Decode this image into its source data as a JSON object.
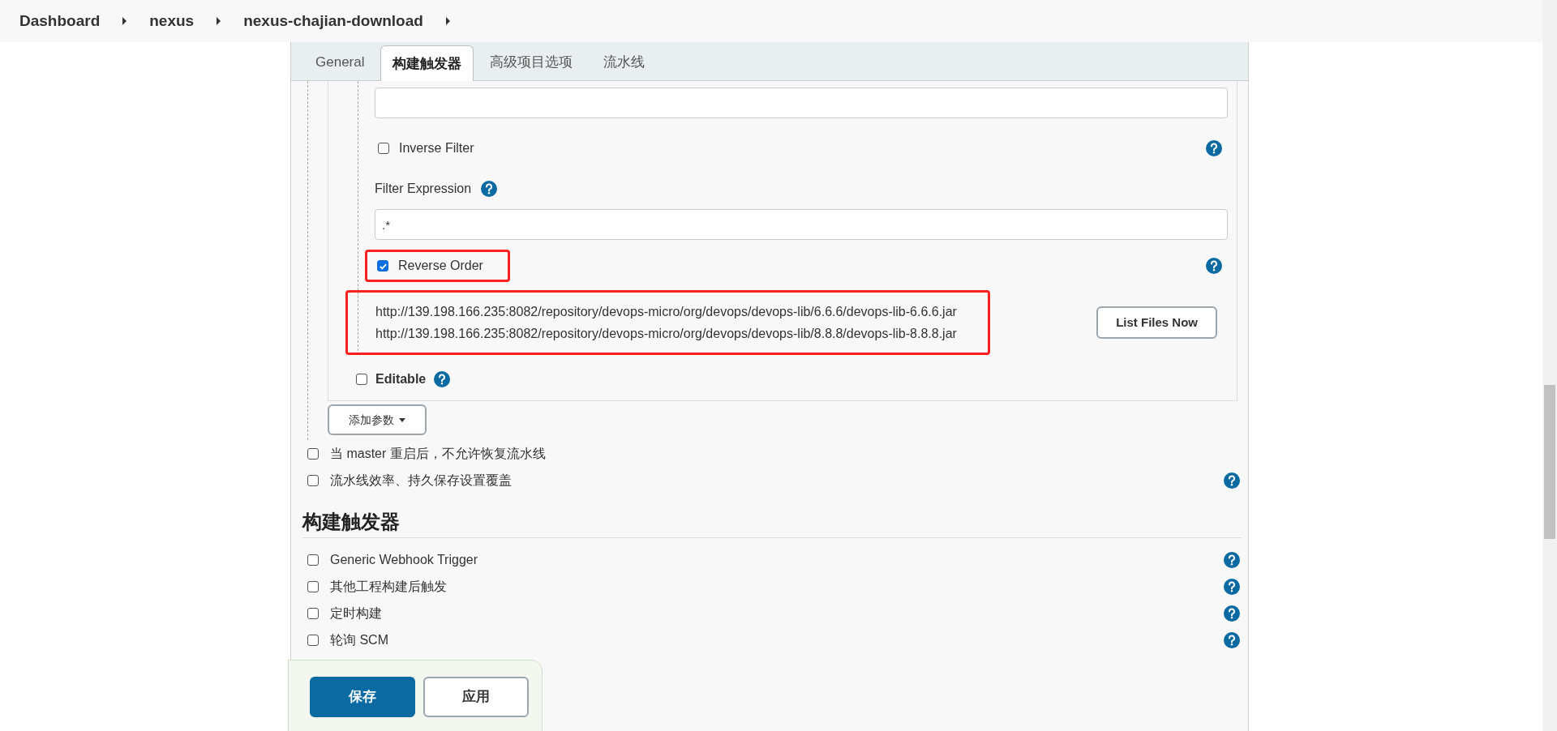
{
  "breadcrumb": [
    "Dashboard",
    "nexus",
    "nexus-chajian-download"
  ],
  "tabs": [
    {
      "label": "General",
      "selected": false
    },
    {
      "label": "构建触发器",
      "selected": true
    },
    {
      "label": "高级项目选项",
      "selected": false
    },
    {
      "label": "流水线",
      "selected": false
    }
  ],
  "parameter": {
    "inverse_filter": {
      "label": "Inverse Filter",
      "checked": false
    },
    "filter_expression": {
      "label": "Filter Expression",
      "value": ".*"
    },
    "reverse_order": {
      "label": "Reverse Order",
      "checked": true
    },
    "file_list": [
      "http://139.198.166.235:8082/repository/devops-micro/org/devops/devops-lib/6.6.6/devops-lib-6.6.6.jar",
      "http://139.198.166.235:8082/repository/devops-micro/org/devops/devops-lib/8.8.8/devops-lib-8.8.8.jar"
    ],
    "list_files_button": "List Files Now",
    "editable": {
      "label": "Editable",
      "checked": false
    }
  },
  "add_parameter_button": "添加参数",
  "options": [
    {
      "label": "当 master 重启后，不允许恢复流水线",
      "checked": false,
      "help": false
    },
    {
      "label": "流水线效率、持久保存设置覆盖",
      "checked": false,
      "help": true
    }
  ],
  "section_heading": "构建触发器",
  "triggers": [
    {
      "label": "Generic Webhook Trigger",
      "checked": false
    },
    {
      "label": "其他工程构建后触发",
      "checked": false
    },
    {
      "label": "定时构建",
      "checked": false
    },
    {
      "label": "轮询 SCM",
      "checked": false
    }
  ],
  "footer": {
    "save_button": "保存",
    "apply_button": "应用"
  }
}
